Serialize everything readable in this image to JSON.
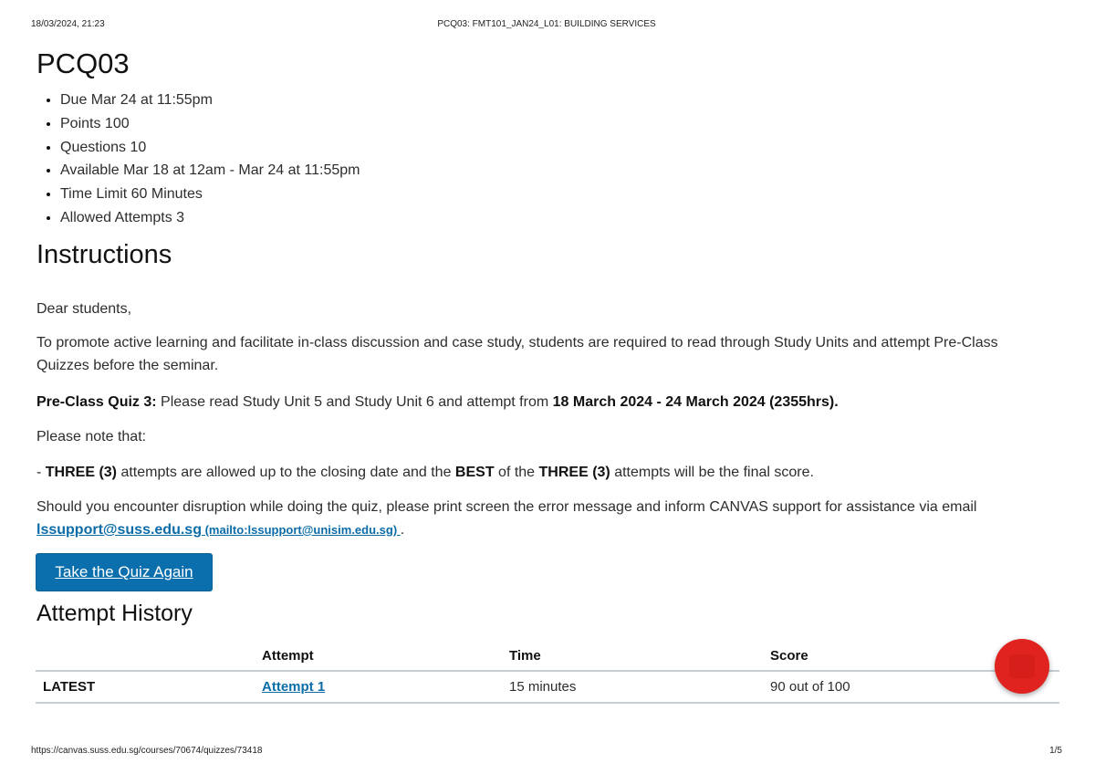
{
  "print_header": {
    "datetime": "18/03/2024, 21:23",
    "page_title": "PCQ03: FMT101_JAN24_L01: BUILDING SERVICES"
  },
  "print_footer": {
    "url": "https://canvas.suss.edu.sg/courses/70674/quizzes/73418",
    "page_number": "1/5"
  },
  "quiz": {
    "title": "PCQ03",
    "details": [
      "Due Mar 24 at 11:55pm",
      "Points 100",
      "Questions 10",
      "Available Mar 18 at 12am - Mar 24 at 11:55pm",
      "Time Limit 60 Minutes",
      "Allowed Attempts 3"
    ]
  },
  "instructions": {
    "heading": "Instructions",
    "greeting": "Dear students,",
    "para_active_learning": "To promote active learning and facilitate in-class discussion and case study, students are required to read through Study Units and attempt Pre-Class Quizzes before the seminar.",
    "quiz_label": "Pre-Class Quiz 3:",
    "quiz_text": " Please read Study Unit 5 and Study Unit 6 and attempt from ",
    "quiz_dates": "18 March 2024 - 24 March 2024 (2355hrs).",
    "note": "Please note that:",
    "attempts_prefix": "- ",
    "attempts_three_1": "THREE (3)",
    "attempts_mid": " attempts are allowed up to the closing date and the ",
    "attempts_best": "BEST",
    "attempts_of": " of the ",
    "attempts_three_2": "THREE (3)",
    "attempts_suffix": " attempts will be the final score.",
    "support_text": "Should you encounter disruption while doing the quiz, please print screen the error message and inform CANVAS support for assistance via email ",
    "support_email": "lssupport@suss.edu.sg",
    "support_mailto": " (mailto:lssupport@unisim.edu.sg) ",
    "support_end": "."
  },
  "take_quiz_button": "Take the Quiz Again",
  "attempt_history": {
    "heading": "Attempt History",
    "columns": [
      "",
      "Attempt",
      "Time",
      "Score"
    ],
    "rows": [
      {
        "label": "LATEST",
        "attempt": "Attempt 1",
        "time": "15 minutes",
        "score": "90 out of 100"
      }
    ]
  },
  "colors": {
    "link": "#0b6ca8",
    "button": "#0a6fac",
    "help_fab": "#e0231e"
  },
  "icons": {
    "help_fab": "help-chat-icon"
  }
}
